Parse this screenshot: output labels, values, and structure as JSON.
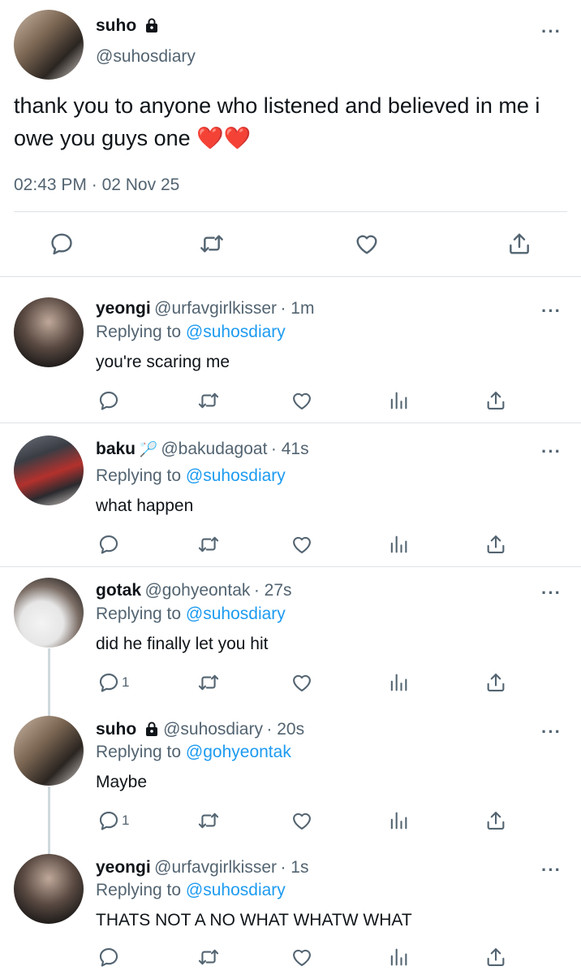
{
  "main_tweet": {
    "name": "suho",
    "handle": "@suhosdiary",
    "text": "thank you to anyone who listened and believed in me i owe you guys one",
    "emoji": "❤️❤️",
    "time": "02:43 PM",
    "date": "02 Nov 25",
    "time_separator": "·"
  },
  "replies": [
    {
      "name": "yeongi",
      "handle": "@urfavgirlkisser",
      "ago": "· 1m",
      "replying_prefix": "Replying to",
      "replying_to": "@suhosdiary",
      "text": "you're scaring me",
      "reply_count": ""
    },
    {
      "name": "baku",
      "badge": "🏸",
      "handle": "@bakudagoat",
      "ago": "· 41s",
      "replying_prefix": "Replying to",
      "replying_to": "@suhosdiary",
      "text": "what happen",
      "reply_count": ""
    },
    {
      "name": "gotak",
      "handle": "@gohyeontak",
      "ago": "· 27s",
      "replying_prefix": "Replying to",
      "replying_to": "@suhosdiary",
      "text": "did he finally let you hit",
      "reply_count": "1"
    },
    {
      "name": "suho",
      "handle": "@suhosdiary",
      "ago": "· 20s",
      "replying_prefix": "Replying to",
      "replying_to": "@gohyeontak",
      "text": "Maybe",
      "reply_count": "1"
    },
    {
      "name": "yeongi",
      "handle": "@urfavgirlkisser",
      "ago": "· 1s",
      "replying_prefix": "Replying to",
      "replying_to": "@suhosdiary",
      "text": "THATS NOT A NO WHAT WHATW WHAT",
      "reply_count": ""
    }
  ],
  "icons": {
    "more": "more-icon",
    "reply": "reply-icon",
    "retweet": "retweet-icon",
    "like": "heart-icon",
    "views": "views-icon",
    "share": "share-icon",
    "lock": "lock-icon"
  },
  "colors": {
    "link": "#1d9bf0",
    "muted": "#536471",
    "text": "#0f1419",
    "divider": "#dfe3e6"
  }
}
